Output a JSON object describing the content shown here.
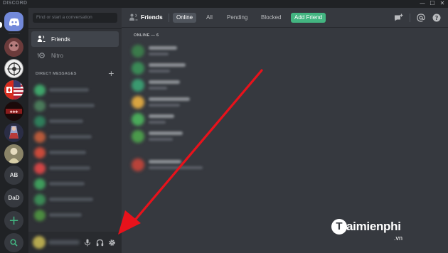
{
  "window": {
    "brand": "DISCORD",
    "controls": [
      "—",
      "☐",
      "✕"
    ]
  },
  "servers": {
    "items": [
      {
        "kind": "home",
        "icon": "discord-logo-icon"
      },
      {
        "kind": "image",
        "icon": "server-avatar-1",
        "color": "#a86a6a"
      },
      {
        "kind": "image",
        "icon": "server-avatar-2",
        "color": "#e8e8e8"
      },
      {
        "kind": "image",
        "icon": "server-avatar-3",
        "color": "#c0303a"
      },
      {
        "kind": "image",
        "icon": "server-avatar-4",
        "color": "#7a1a1a"
      },
      {
        "kind": "image",
        "icon": "server-avatar-5",
        "color": "#6a6f99"
      },
      {
        "kind": "image",
        "icon": "server-avatar-6",
        "color": "#c8bf9a"
      },
      {
        "kind": "text",
        "label": "AB"
      },
      {
        "kind": "text",
        "label": "DaD"
      },
      {
        "kind": "add",
        "icon": "plus-icon",
        "label": "+"
      },
      {
        "kind": "search",
        "icon": "search-icon"
      }
    ]
  },
  "sidebar": {
    "search_placeholder": "Find or start a conversation",
    "nav": [
      {
        "label": "Friends",
        "icon": "friends-icon",
        "active": true
      },
      {
        "label": "Nitro",
        "icon": "nitro-icon",
        "active": false
      }
    ],
    "dm_header": "DIRECT MESSAGES",
    "dm_add": "+"
  },
  "user_panel": {
    "buttons": [
      "microphone-icon",
      "headphones-icon",
      "settings-icon"
    ]
  },
  "header": {
    "title": "Friends",
    "tabs": [
      {
        "label": "Online",
        "active": true
      },
      {
        "label": "All",
        "active": false
      },
      {
        "label": "Pending",
        "active": false
      },
      {
        "label": "Blocked",
        "active": false
      }
    ],
    "add_friend": "Add Friend",
    "right_icons": [
      "new-group-dm-icon",
      "mentions-icon",
      "help-icon"
    ]
  },
  "friends": {
    "online_header": "ONLINE — 6"
  },
  "watermark": {
    "initial": "T",
    "name": "aimienphi",
    "domain": ".vn"
  },
  "colors": {
    "accent": "#7289da",
    "green": "#43b581",
    "arrow": "#e8121b"
  }
}
